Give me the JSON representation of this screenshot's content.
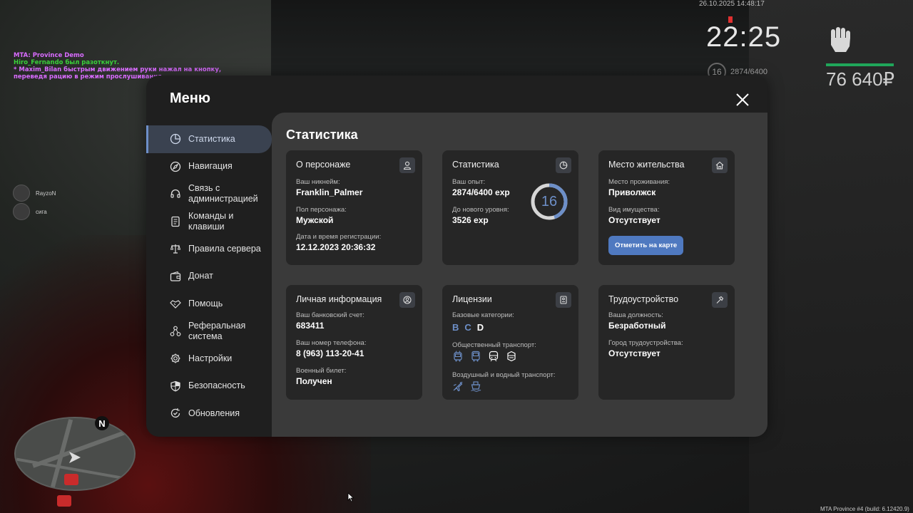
{
  "hud": {
    "chat": [
      "MTA: Province Demo",
      "Hiro_Fernando был разоткнут.",
      " * Maxim_Bilan быстрым движением руки нажал на кнопку, переведя рацию в режим прослушивания"
    ],
    "voice_users": [
      "RayzoN",
      "сига"
    ],
    "datetime": "26.10.2025 14:48:17",
    "clock": "22:25",
    "level": "16",
    "experience": "2874/6400",
    "money": "76 640₽",
    "minimap_north": "N",
    "build_info": "MTA Province #4 (build: 6.12420.9)"
  },
  "menu": {
    "title": "Меню",
    "sidebar": [
      {
        "label": "Статистика",
        "icon": "pie-chart-icon",
        "active": true
      },
      {
        "label": "Навигация",
        "icon": "compass-icon"
      },
      {
        "label": "Связь с администрацией",
        "icon": "headset-icon"
      },
      {
        "label": "Команды и клавиши",
        "icon": "document-icon"
      },
      {
        "label": "Правила сервера",
        "icon": "scales-icon"
      },
      {
        "label": "Донат",
        "icon": "wallet-icon"
      },
      {
        "label": "Помощь",
        "icon": "handshake-icon"
      },
      {
        "label": "Реферальная система",
        "icon": "network-icon"
      },
      {
        "label": "Настройки",
        "icon": "gear-icon"
      },
      {
        "label": "Безопасность",
        "icon": "shield-icon"
      },
      {
        "label": "Обновления",
        "icon": "refresh-check-icon"
      }
    ],
    "content_title": "Статистика",
    "character": {
      "title": "О персонаже",
      "nick_label": "Ваш никнейм:",
      "nick": "Franklin_Palmer",
      "gender_label": "Пол персонажа:",
      "gender": "Мужской",
      "reg_label": "Дата и время регистрации:",
      "reg": "12.12.2023 20:36:32"
    },
    "stats": {
      "title": "Статистика",
      "exp_label": "Ваш опыт:",
      "exp": "2874/6400 exp",
      "next_label": "До нового уровня:",
      "next": "3526 exp",
      "level": "16",
      "progress": 0.449
    },
    "residence": {
      "title": "Место жительства",
      "place_label": "Место проживания:",
      "place": "Приволжск",
      "property_label": "Вид имущества:",
      "property": "Отсутствует",
      "button": "Отметить на карте"
    },
    "personal": {
      "title": "Личная информация",
      "bank_label": "Ваш банковский счет:",
      "bank": "683411",
      "phone_label": "Ваш номер телефона:",
      "phone": "8 (963) 113-20-41",
      "military_label": "Военный билет:",
      "military": "Получен"
    },
    "licenses": {
      "title": "Лицензии",
      "base_label": "Базовые категории:",
      "categories": [
        {
          "name": "B",
          "has": true
        },
        {
          "name": "C",
          "has": true
        },
        {
          "name": "D",
          "has": false
        }
      ],
      "public_label": "Общественный транспорт:",
      "public_icons": [
        "trolleybus-icon",
        "bus-icon",
        "train-icon",
        "tram-icon"
      ],
      "air_label": "Воздушный и водный транспорт:",
      "air_icons": [
        "plane-icon",
        "boat-icon"
      ]
    },
    "employment": {
      "title": "Трудоустройство",
      "position_label": "Ваша должность:",
      "position": "Безработный",
      "city_label": "Город трудоустройства:",
      "city": "Отсутствует"
    },
    "colors": {
      "accent": "#6d8fc8",
      "button": "#4f79c0",
      "panel": "#1f1f1f",
      "content": "#3a3a3a",
      "card": "#262626"
    }
  }
}
